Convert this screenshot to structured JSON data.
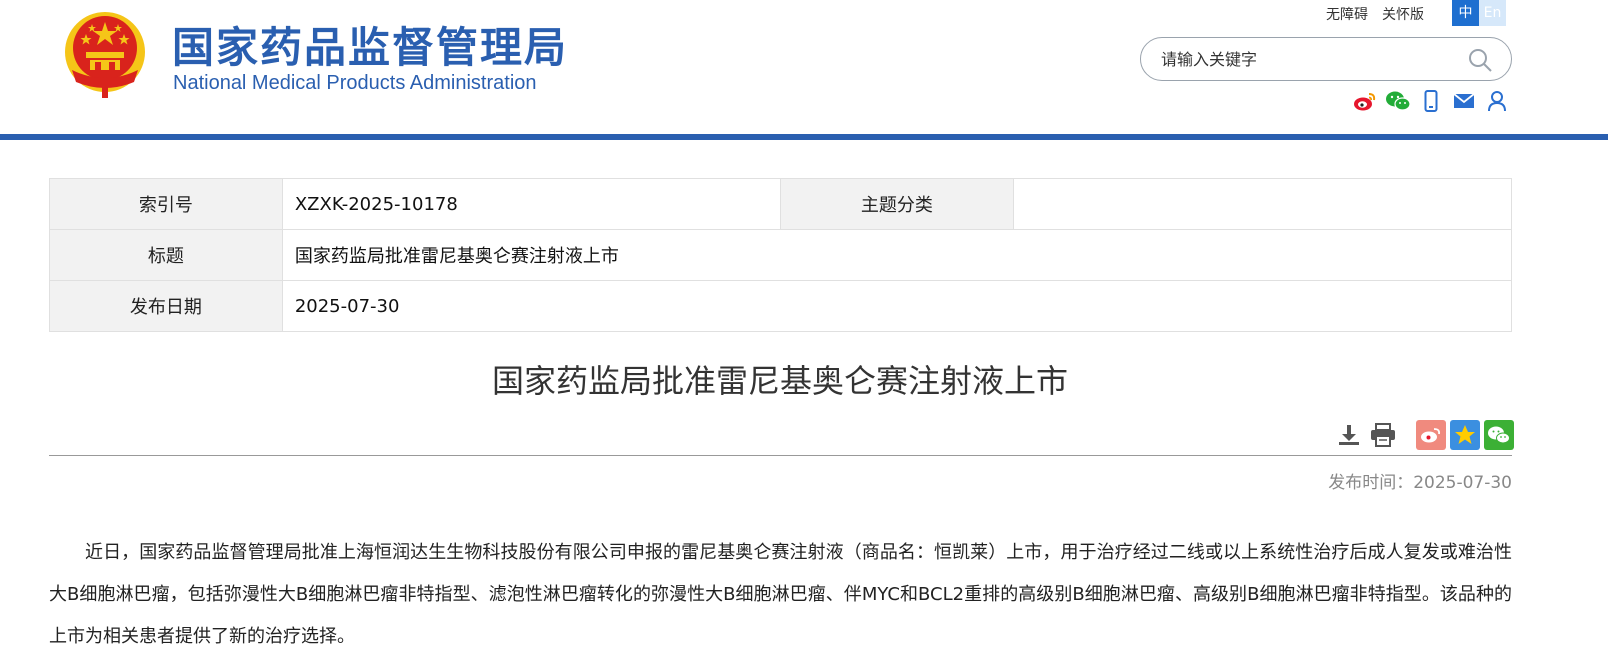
{
  "header": {
    "title_cn": "国家药品监督管理局",
    "title_en": "National Medical Products Administration",
    "links": {
      "accessibility": "无障碍",
      "elderly": "关怀版"
    },
    "lang": {
      "zh": "中",
      "en": "En"
    },
    "search": {
      "placeholder": "请输入关键字"
    },
    "colors": {
      "brand_blue": "#2a5fb0",
      "lang_active": "#1e6fd0",
      "emblem_red": "#d9231c",
      "emblem_gold": "#f5c518"
    },
    "social_icons": [
      "weibo-icon",
      "wechat-icon",
      "mobile-icon",
      "mail-icon",
      "user-icon"
    ]
  },
  "info_table": {
    "index_label": "索引号",
    "index_value": "XZXK-2025-10178",
    "topic_label": "主题分类",
    "topic_value": "",
    "title_label": "标题",
    "title_value": "国家药监局批准雷尼基奥仑赛注射液上市",
    "date_label": "发布日期",
    "date_value": "2025-07-30"
  },
  "article": {
    "title": "国家药监局批准雷尼基奥仑赛注射液上市",
    "publish_label": "发布时间：",
    "publish_date": "2025-07-30",
    "body": "近日，国家药品监督管理局批准上海恒润达生生物科技股份有限公司申报的雷尼基奥仑赛注射液（商品名：恒凯莱）上市，用于治疗经过二线或以上系统性治疗后成人复发或难治性大B细胞淋巴瘤，包括弥漫性大B细胞淋巴瘤非特指型、滤泡性淋巴瘤转化的弥漫性大B细胞淋巴瘤、伴MYC和BCL2重排的高级别B细胞淋巴瘤、高级别B细胞淋巴瘤非特指型。该品种的上市为相关患者提供了新的治疗选择。",
    "tool_icons": [
      "download-icon",
      "print-icon",
      "share-weibo-icon",
      "share-qzone-icon",
      "share-wechat-icon"
    ]
  }
}
